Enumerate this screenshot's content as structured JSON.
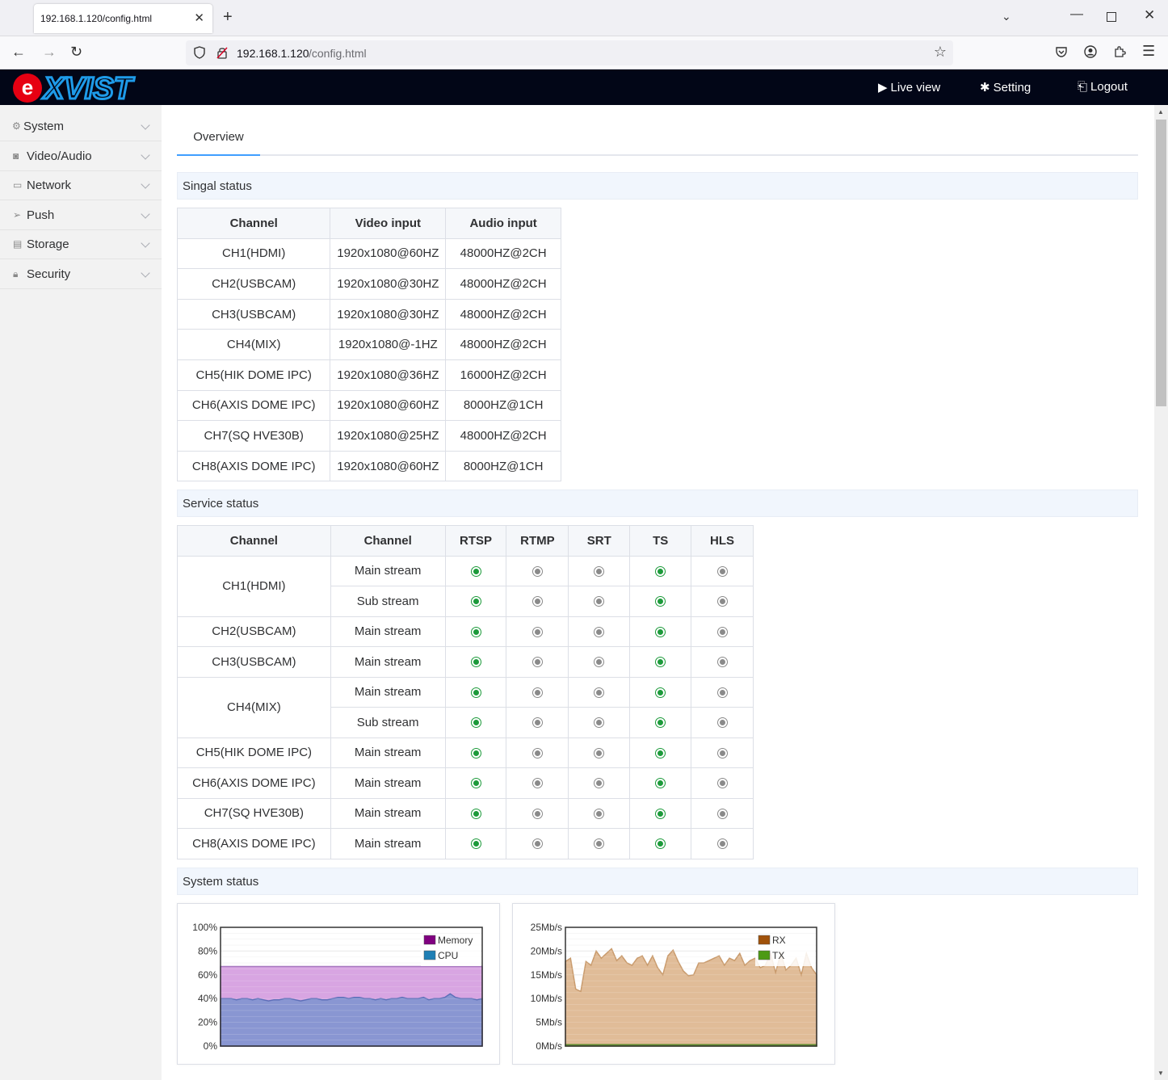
{
  "browser": {
    "tab_title": "192.168.1.120/config.html",
    "url_host": "192.168.1.120",
    "url_path": "/config.html"
  },
  "header": {
    "logo_text": "eXVIST",
    "live_view": "Live view",
    "setting": "Setting",
    "logout": "Logout"
  },
  "sidebar": {
    "items": [
      {
        "label": "System",
        "icon": "gear-icon"
      },
      {
        "label": "Video/Audio",
        "icon": "camera-icon"
      },
      {
        "label": "Network",
        "icon": "monitor-icon"
      },
      {
        "label": "Push",
        "icon": "send-icon"
      },
      {
        "label": "Storage",
        "icon": "disk-icon"
      },
      {
        "label": "Security",
        "icon": "lock-icon"
      }
    ]
  },
  "main": {
    "tab_overview": "Overview",
    "signal_section": "Singal status",
    "service_section": "Service status",
    "system_section": "System status"
  },
  "signal_table": {
    "headers": [
      "Channel",
      "Video input",
      "Audio input"
    ],
    "rows": [
      [
        "CH1(HDMI)",
        "1920x1080@60HZ",
        "48000HZ@2CH"
      ],
      [
        "CH2(USBCAM)",
        "1920x1080@30HZ",
        "48000HZ@2CH"
      ],
      [
        "CH3(USBCAM)",
        "1920x1080@30HZ",
        "48000HZ@2CH"
      ],
      [
        "CH4(MIX)",
        "1920x1080@-1HZ",
        "48000HZ@2CH"
      ],
      [
        "CH5(HIK DOME IPC)",
        "1920x1080@36HZ",
        "16000HZ@2CH"
      ],
      [
        "CH6(AXIS DOME IPC)",
        "1920x1080@60HZ",
        "8000HZ@1CH"
      ],
      [
        "CH7(SQ HVE30B)",
        "1920x1080@25HZ",
        "48000HZ@2CH"
      ],
      [
        "CH8(AXIS DOME IPC)",
        "1920x1080@60HZ",
        "8000HZ@1CH"
      ]
    ]
  },
  "service_table": {
    "headers": [
      "Channel",
      "Channel",
      "RTSP",
      "RTMP",
      "SRT",
      "TS",
      "HLS"
    ],
    "rows": [
      {
        "channel": "CH1(HDMI)",
        "rowspan": 2,
        "stream": "Main stream",
        "status": [
          1,
          0,
          0,
          1,
          0
        ]
      },
      {
        "channel": null,
        "stream": "Sub stream",
        "status": [
          1,
          0,
          0,
          1,
          0
        ]
      },
      {
        "channel": "CH2(USBCAM)",
        "rowspan": 1,
        "stream": "Main stream",
        "status": [
          1,
          0,
          0,
          1,
          0
        ]
      },
      {
        "channel": "CH3(USBCAM)",
        "rowspan": 1,
        "stream": "Main stream",
        "status": [
          1,
          0,
          0,
          1,
          0
        ]
      },
      {
        "channel": "CH4(MIX)",
        "rowspan": 2,
        "stream": "Main stream",
        "status": [
          1,
          0,
          0,
          1,
          0
        ]
      },
      {
        "channel": null,
        "stream": "Sub stream",
        "status": [
          1,
          0,
          0,
          1,
          0
        ]
      },
      {
        "channel": "CH5(HIK DOME IPC)",
        "rowspan": 1,
        "stream": "Main stream",
        "status": [
          1,
          0,
          0,
          1,
          0
        ]
      },
      {
        "channel": "CH6(AXIS DOME IPC)",
        "rowspan": 1,
        "stream": "Main stream",
        "status": [
          1,
          0,
          0,
          1,
          0
        ]
      },
      {
        "channel": "CH7(SQ HVE30B)",
        "rowspan": 1,
        "stream": "Main stream",
        "status": [
          1,
          0,
          0,
          1,
          0
        ]
      },
      {
        "channel": "CH8(AXIS DOME IPC)",
        "rowspan": 1,
        "stream": "Main stream",
        "status": [
          1,
          0,
          0,
          1,
          0
        ]
      }
    ]
  },
  "colors": {
    "active": "#1c9a3a",
    "inactive": "#8a8a8a",
    "memory": "#d6a0e0",
    "cpu": "#8595d1",
    "rx": "#deb892",
    "tx": "#7fb24a",
    "accent": "#409eff"
  },
  "chart_data": [
    {
      "type": "area",
      "yticks": [
        "100%",
        "80%",
        "60%",
        "40%",
        "20%",
        "0%"
      ],
      "ylim": [
        0,
        100
      ],
      "legend_placement": "top-right",
      "series": [
        {
          "name": "Memory",
          "color": "#800080",
          "values": [
            67,
            67,
            67,
            67,
            67,
            67,
            67,
            67,
            67,
            67,
            67,
            67,
            67,
            67,
            67,
            67,
            67,
            67,
            67,
            67,
            67,
            67,
            67,
            67,
            67,
            67,
            67,
            67,
            67,
            67,
            67,
            67,
            67,
            67,
            67,
            67,
            67,
            67,
            67,
            67,
            67,
            67,
            67,
            67,
            67,
            67,
            67,
            67,
            67,
            67
          ]
        },
        {
          "name": "CPU",
          "color": "#1f7fb5",
          "values": [
            40,
            40,
            40,
            39,
            40,
            40,
            39,
            40,
            39,
            38,
            39,
            39,
            40,
            40,
            39,
            38,
            39,
            40,
            40,
            39,
            39,
            40,
            41,
            41,
            40,
            41,
            41,
            40,
            40,
            39,
            40,
            39,
            40,
            40,
            41,
            40,
            40,
            40,
            41,
            39,
            40,
            40,
            41,
            44,
            41,
            40,
            40,
            40,
            39,
            40
          ]
        }
      ]
    },
    {
      "type": "area",
      "yticks": [
        "25Mb/s",
        "20Mb/s",
        "15Mb/s",
        "10Mb/s",
        "5Mb/s",
        "0Mb/s"
      ],
      "ylim": [
        0,
        25
      ],
      "legend_placement": "top-right",
      "series": [
        {
          "name": "RX",
          "color": "#a0520a",
          "values": [
            17.8,
            18.5,
            12,
            11.5,
            17.8,
            17,
            20,
            18.5,
            19.5,
            20.5,
            18,
            19,
            17.5,
            17,
            18.5,
            19,
            17,
            19,
            16.5,
            15,
            19,
            20.2,
            17.8,
            15.8,
            14.8,
            15,
            17.5,
            17.5,
            18,
            18.5,
            19,
            17,
            18.5,
            18,
            19.5,
            17,
            18,
            18.5,
            16.5,
            17,
            19.5,
            15.5,
            19.5,
            16,
            17,
            18.5,
            15,
            19.5,
            16.5,
            15
          ]
        },
        {
          "name": "TX",
          "color": "#4c9a14",
          "values": [
            0.3,
            0.3,
            0.3,
            0.3,
            0.3,
            0.3,
            0.3,
            0.3,
            0.3,
            0.3,
            0.3,
            0.3,
            0.3,
            0.3,
            0.3,
            0.3,
            0.3,
            0.3,
            0.3,
            0.3,
            0.3,
            0.3,
            0.3,
            0.3,
            0.3,
            0.3,
            0.3,
            0.3,
            0.3,
            0.3,
            0.3,
            0.3,
            0.3,
            0.3,
            0.3,
            0.3,
            0.3,
            0.3,
            0.3,
            0.3,
            0.3,
            0.3,
            0.3,
            0.3,
            0.3,
            0.3,
            0.3,
            0.3,
            0.3,
            0.3
          ]
        }
      ]
    }
  ]
}
